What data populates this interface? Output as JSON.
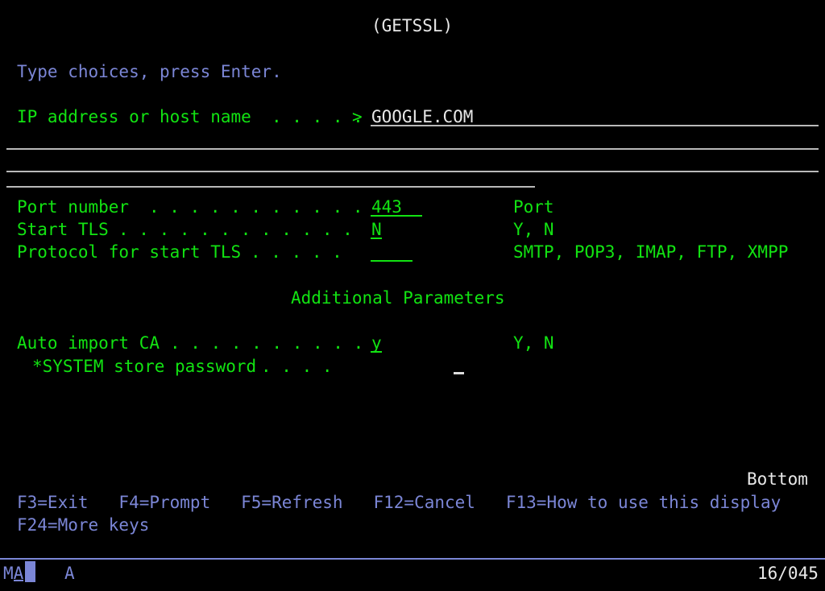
{
  "terminal": {
    "type": "ibm-5250-green-screen",
    "colors": {
      "background": "#000000",
      "green": "#12e312",
      "white": "#e8e8e8",
      "blue": "#7b86d6",
      "underline_white": "#b9b9b9",
      "cursor_blue": "#7b86d6"
    },
    "grid": {
      "columns": 80,
      "rows": 24,
      "char_width": 12.6,
      "row_height": 28.5
    }
  },
  "header": {
    "title": "(GETSSL)"
  },
  "instruction": {
    "text": "Type choices, press Enter."
  },
  "fields": {
    "host": {
      "label": "IP address or host name",
      "leader": ". . . . .",
      "prompt_char": ">",
      "value": "GOOGLE.COM",
      "continuation_rows": 3
    },
    "port": {
      "label": "Port number",
      "leader": ". . . . . . . . . . .",
      "value": "443",
      "hint": "Port"
    },
    "start_tls": {
      "label": "Start TLS",
      "leader": ". . . . . . . . . . . .",
      "value": "N",
      "hint": "Y, N"
    },
    "protocol": {
      "label": "Protocol for start TLS",
      "leader": ". . . . .",
      "value": "",
      "hint": "SMTP, POP3, IMAP, FTP, XMPP"
    },
    "auto_import_ca": {
      "label": "Auto import CA",
      "leader": ". . . . . . . . . .",
      "value": "y",
      "hint": "Y, N"
    },
    "system_store_password": {
      "label": "*SYSTEM store password",
      "leader": ". . . .",
      "value": "",
      "hint": ""
    }
  },
  "sections": {
    "additional_parameters": "Additional Parameters"
  },
  "page_indicator": {
    "text": "Bottom"
  },
  "function_keys": {
    "row1": "F3=Exit   F4=Prompt   F5=Refresh   F12=Cancel   F13=How to use this display",
    "row2": "F24=More keys",
    "items": [
      {
        "key": "F3",
        "label": "Exit"
      },
      {
        "key": "F4",
        "label": "Prompt"
      },
      {
        "key": "F5",
        "label": "Refresh"
      },
      {
        "key": "F12",
        "label": "Cancel"
      },
      {
        "key": "F13",
        "label": "How to use this display"
      },
      {
        "key": "F24",
        "label": "More keys"
      }
    ]
  },
  "status_bar": {
    "left_indicator": "MA",
    "insert_indicator": "A",
    "cursor_position": "16/045"
  }
}
